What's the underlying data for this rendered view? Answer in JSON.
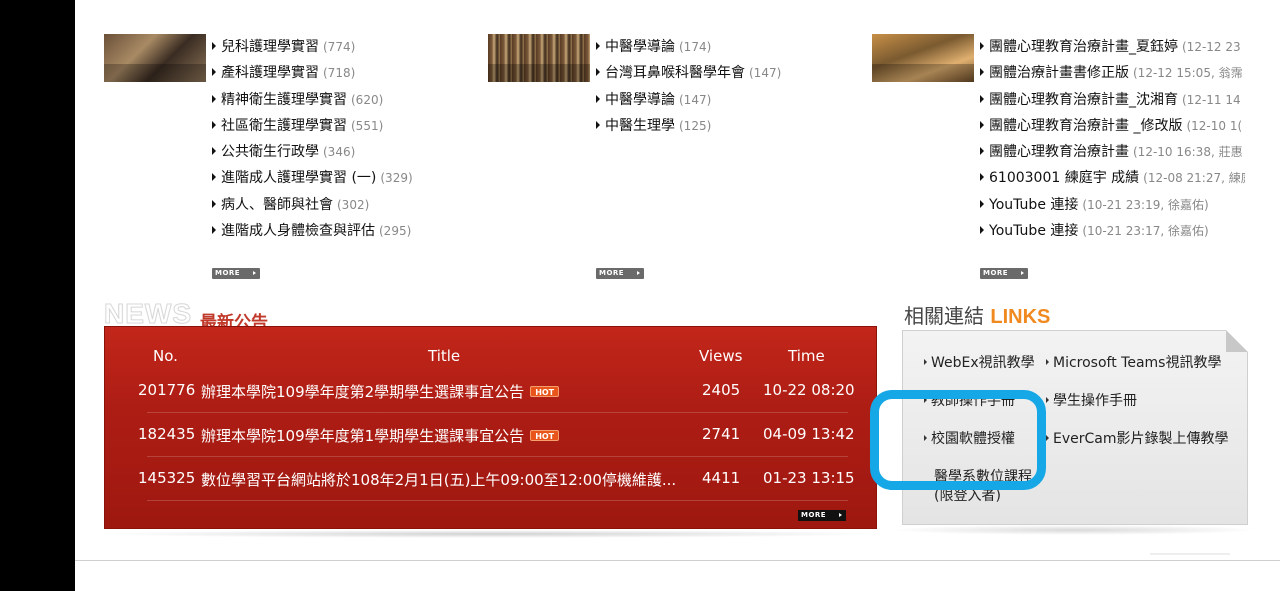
{
  "columns": [
    {
      "items": [
        {
          "title": "兒科護理學實習",
          "count": "(774)"
        },
        {
          "title": "產科護理學實習",
          "count": "(718)"
        },
        {
          "title": "精神衛生護理學實習",
          "count": "(620)"
        },
        {
          "title": "社區衛生護理學實習",
          "count": "(551)"
        },
        {
          "title": "公共衛生行政學",
          "count": "(346)"
        },
        {
          "title": "進階成人護理學實習 (一)",
          "count": "(329)"
        },
        {
          "title": "病人、醫師與社會",
          "count": "(302)"
        },
        {
          "title": "進階成人身體檢查與評估",
          "count": "(295)"
        }
      ],
      "more": "MORE"
    },
    {
      "items": [
        {
          "title": "中醫學導論",
          "count": "(174)"
        },
        {
          "title": "台灣耳鼻喉科醫學年會",
          "count": "(147)"
        },
        {
          "title": "中醫學導論",
          "count": "(147)"
        },
        {
          "title": "中醫生理學",
          "count": "(125)"
        }
      ],
      "more": "MORE"
    },
    {
      "items": [
        {
          "title": "團體心理教育治療計畫_夏鈺婷",
          "count": "(12-12 23"
        },
        {
          "title": "團體治療計畫書修正版",
          "count": "(12-12 15:05, 翁霈"
        },
        {
          "title": "團體心理教育治療計畫_沈湘育",
          "count": "(12-11 14"
        },
        {
          "title": "團體心理教育治療計畫 _修改版",
          "count": "(12-10 1("
        },
        {
          "title": "團體心理教育治療計畫",
          "count": "(12-10 16:38, 莊惠"
        },
        {
          "title": "61003001 練庭宇 成績",
          "count": "(12-08 21:27, 練庭"
        },
        {
          "title": "YouTube 連接",
          "count": "(10-21 23:19, 徐嘉佑)"
        },
        {
          "title": "YouTube 連接",
          "count": "(10-21 23:17, 徐嘉佑)"
        }
      ],
      "more": "MORE"
    }
  ],
  "news": {
    "heading_en": "NEWS",
    "heading_zh": "最新公告",
    "columns": {
      "no": "No.",
      "title": "Title",
      "views": "Views",
      "time": "Time"
    },
    "rows": [
      {
        "no": "201776",
        "title": "辦理本學院109學年度第2學期學生選課事宜公告",
        "hot": "HOT",
        "views": "2405",
        "time": "10-22 08:20"
      },
      {
        "no": "182435",
        "title": "辦理本學院109學年度第1學期學生選課事宜公告",
        "hot": "HOT",
        "views": "2741",
        "time": "04-09 13:42"
      },
      {
        "no": "145325",
        "title": "數位學習平台網站將於108年2月1日(五)上午09:00至12:00停機維護...",
        "hot": "",
        "views": "4411",
        "time": "01-23 13:15"
      }
    ],
    "more": "MORE"
  },
  "links": {
    "title_zh": "相關連結",
    "title_en": "LINKS",
    "items": [
      {
        "label": "WebEx視訊教學"
      },
      {
        "label": "Microsoft Teams視訊教學"
      },
      {
        "label": "教師操作手冊"
      },
      {
        "label": "學生操作手冊"
      },
      {
        "label": "校園軟體授權"
      },
      {
        "label": "EverCam影片錄製上傳教學"
      },
      {
        "label": "醫學系數位課程(限登入者)"
      }
    ]
  },
  "colors": {
    "news_red": "#b3211a",
    "links_orange": "#f08a20",
    "highlight_blue": "#16a8e6"
  }
}
